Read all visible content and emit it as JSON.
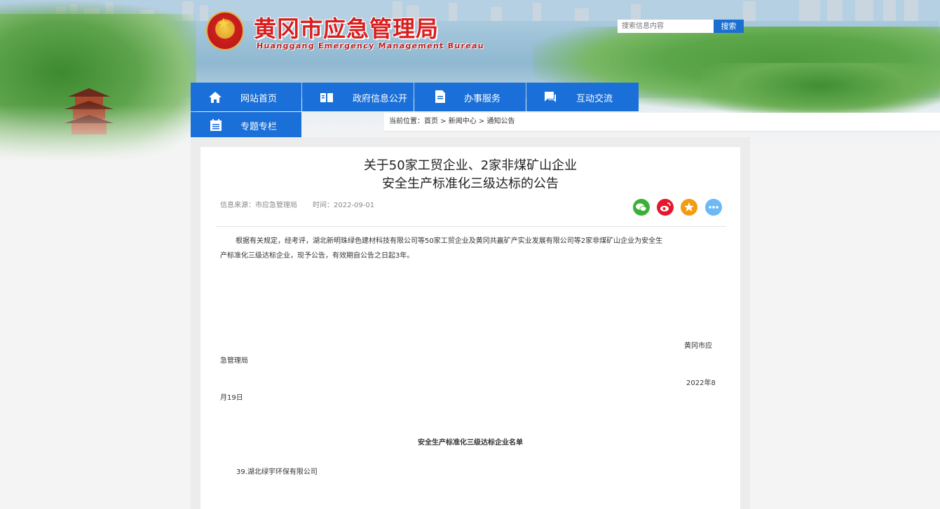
{
  "site": {
    "title_cn": "黄冈市应急管理局",
    "title_en": "Huanggang Emergency Management Bureau"
  },
  "search": {
    "placeholder": "搜索信息内容",
    "button": "搜索"
  },
  "nav": {
    "items": [
      {
        "label": "网站首页",
        "icon": "home-icon"
      },
      {
        "label": "政府信息公开",
        "icon": "book-icon"
      },
      {
        "label": "办事服务",
        "icon": "document-icon"
      },
      {
        "label": "互动交流",
        "icon": "chat-icon"
      },
      {
        "label": "专题专栏",
        "icon": "list-icon"
      }
    ]
  },
  "breadcrumb": {
    "prefix": "当前位置：",
    "items": [
      "首页",
      "新闻中心",
      "通知公告"
    ],
    "separator": " > "
  },
  "article": {
    "title_line1": "关于50家工贸企业、2家非煤矿山企业",
    "title_line2": "安全生产标准化三级达标的公告",
    "source": "信息来源：市应急管理局",
    "time": "时间：2022-09-01",
    "body_line1": "根据有关规定，经考评，湖北新明珠绿色建材科技有限公司等50家工贸企业及黄冈共赢矿产实业发展有限公司等2家非煤矿山企业为安全生",
    "body_line2": "产标准化三级达标企业，现予公告，有效期自公告之日起3年。",
    "signature_a": "黄冈市应",
    "signature_b": "急管理局",
    "date_a": "2022年8",
    "date_b": "月19日",
    "list_title": "安全生产标准化三级达标企业名单",
    "list_item": "39.湖北绿宇环保有限公司"
  },
  "share": {
    "icons": [
      "wechat-icon",
      "weibo-icon",
      "favorite-icon",
      "more-icon"
    ],
    "colors": {
      "wechat": "#3cb035",
      "weibo": "#e6162d",
      "favorite": "#f39c12",
      "more": "#6cb9f5"
    }
  },
  "colors": {
    "nav_blue": "#1a6fd8",
    "title_red": "#d81e1e"
  }
}
